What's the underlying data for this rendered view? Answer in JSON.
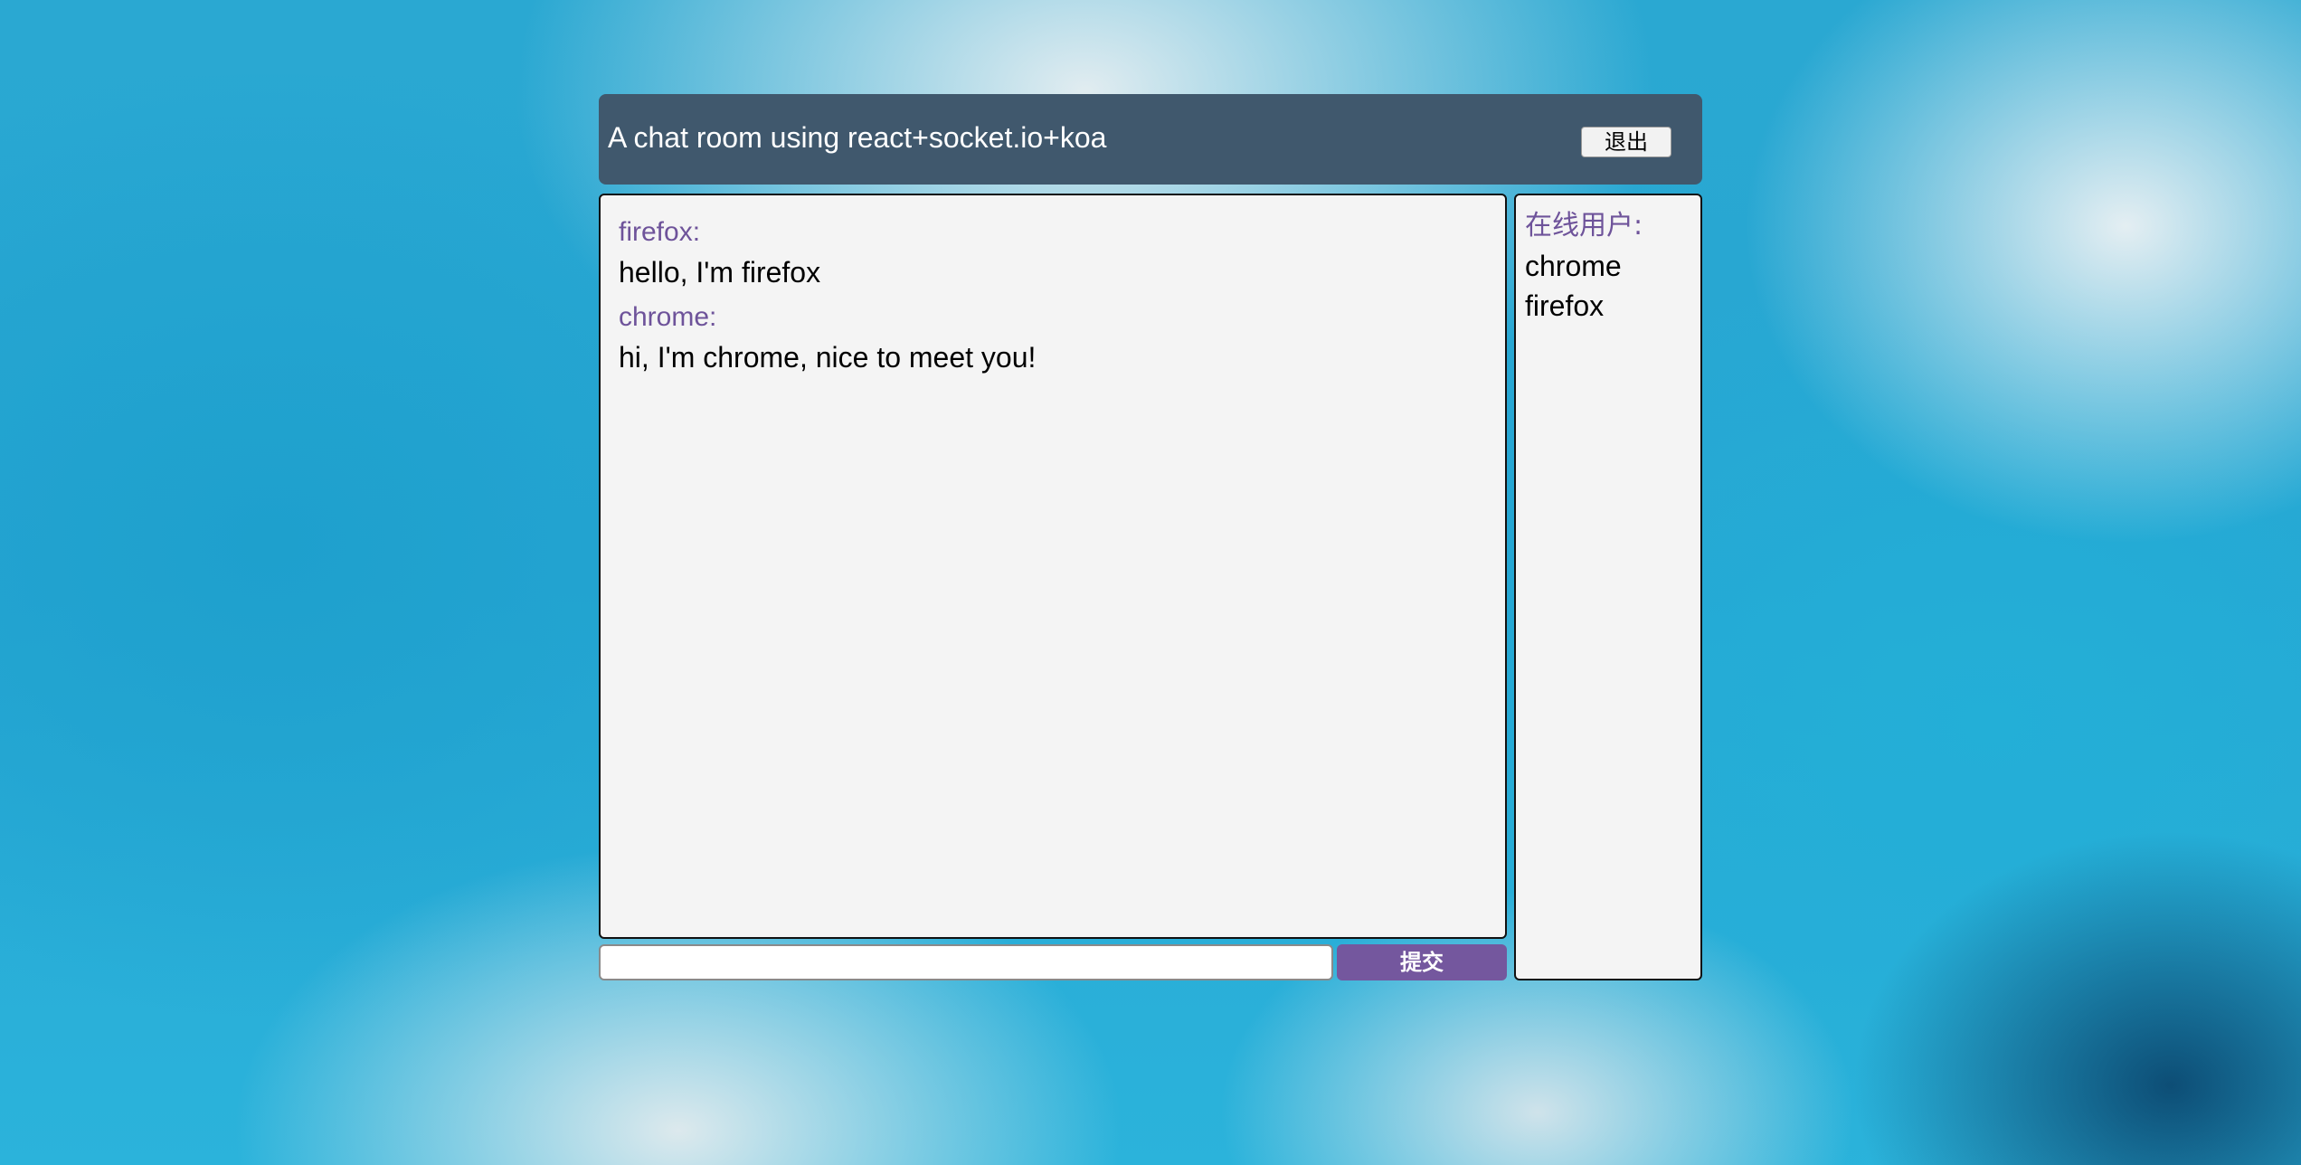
{
  "header": {
    "title": "A chat room using react+socket.io+koa",
    "logout_label": "退出"
  },
  "messages": [
    {
      "user": "firefox:",
      "text": "hello, I'm firefox"
    },
    {
      "user": "chrome:",
      "text": "hi, I'm chrome, nice to meet you!"
    }
  ],
  "online": {
    "title": "在线用户:",
    "users": [
      "chrome",
      "firefox"
    ]
  },
  "composer": {
    "input_value": "",
    "submit_label": "提交"
  },
  "colors": {
    "header_bg": "#40586d",
    "accent_purple": "#74579e",
    "username_purple": "#6e539a",
    "panel_bg": "#f4f4f4"
  }
}
